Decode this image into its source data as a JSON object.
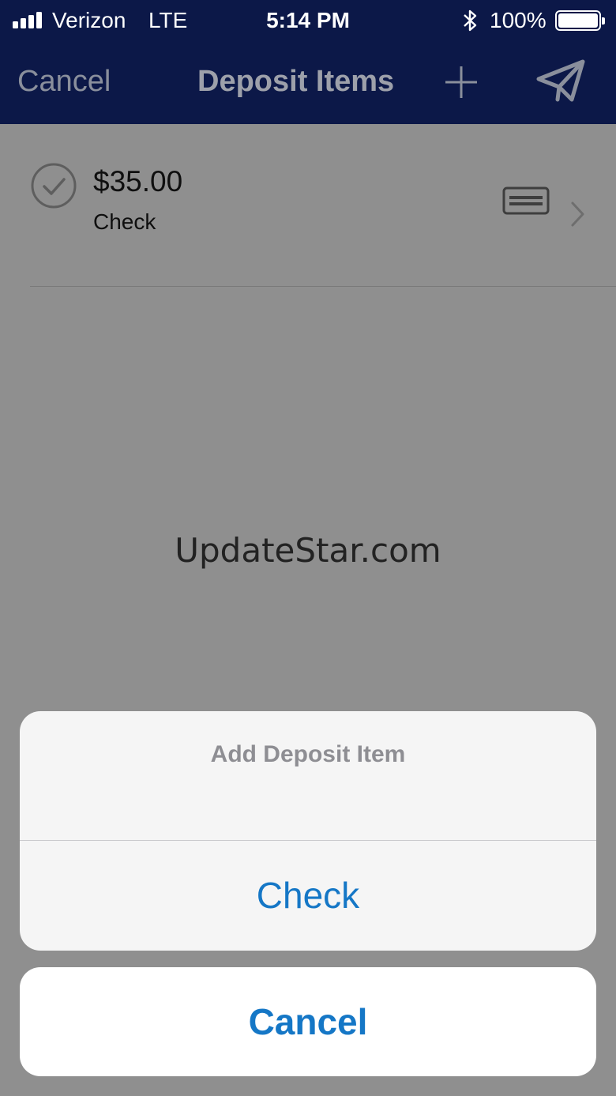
{
  "status_bar": {
    "carrier": "Verizon",
    "network": "LTE",
    "time": "5:14 PM",
    "battery_percent": "100%",
    "bluetooth_icon": "bluetooth-icon",
    "battery_icon": "battery-icon",
    "signal_icon": "signal-bars-icon"
  },
  "nav": {
    "cancel_label": "Cancel",
    "title": "Deposit Items",
    "add_icon": "plus-icon",
    "submit_icon": "paper-plane-icon",
    "background_color": "#0c1848"
  },
  "deposit_items": [
    {
      "amount": "$35.00",
      "type": "Check",
      "status_icon": "checkmark-circle-icon",
      "type_icon": "check-card-icon",
      "disclosure_icon": "chevron-right-icon"
    }
  ],
  "watermark": "UpdateStar.com",
  "action_sheet": {
    "title": "Add Deposit Item",
    "options": [
      "Check"
    ],
    "cancel_label": "Cancel",
    "accent_color": "#1577c6"
  }
}
